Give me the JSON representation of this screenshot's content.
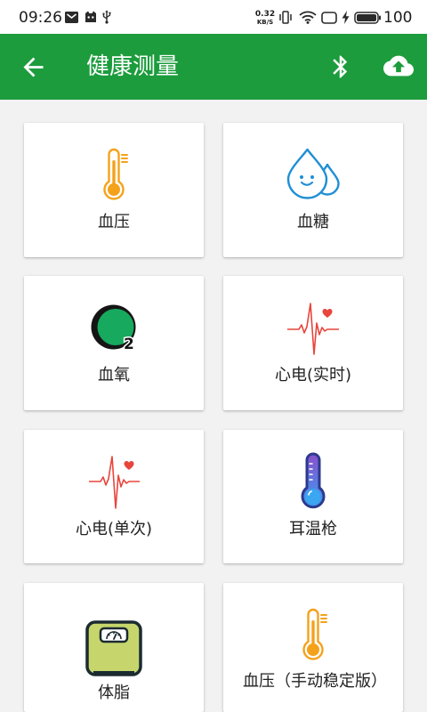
{
  "status_bar": {
    "time": "09:26",
    "notification_icons": [
      "mail-icon",
      "cat-icon",
      "usb-icon"
    ],
    "net_speed": {
      "value": "0.32",
      "unit": "KB/S"
    },
    "system_icons": [
      "vibrate-icon",
      "wifi-icon",
      "screen-icon",
      "charging-bolt-icon",
      "battery-icon"
    ],
    "battery_level": "100"
  },
  "app_bar": {
    "title": "健康测量",
    "navigation_icon": "arrow-back-icon",
    "action_icons": [
      "bluetooth-icon",
      "cloud-upload-icon"
    ]
  },
  "theme": {
    "primary": "#1C9C3C",
    "background": "#F2F2F2",
    "card": "#FFFFFF",
    "thermometer_orange": "#F4A21C",
    "drop_blue": "#1F8FD5",
    "ecg_red": "#E8453C",
    "oxygen_green": "#17A95E",
    "scale_green": "#C6D66C"
  },
  "measurements": [
    {
      "label": "血压",
      "icon": "thermometer-icon"
    },
    {
      "label": "血糖",
      "icon": "water-drops-icon"
    },
    {
      "label": "血氧",
      "icon": "oxygen-icon",
      "icon_text": "2"
    },
    {
      "label": "心电(实时)",
      "icon": "ecg-heart-icon"
    },
    {
      "label": "心电(单次)",
      "icon": "ecg-heart-icon"
    },
    {
      "label": "耳温枪",
      "icon": "ear-thermometer-icon"
    },
    {
      "label": "体脂",
      "icon": "body-scale-icon"
    },
    {
      "label": "血压（手动稳定版）",
      "icon": "thermometer-icon"
    }
  ]
}
